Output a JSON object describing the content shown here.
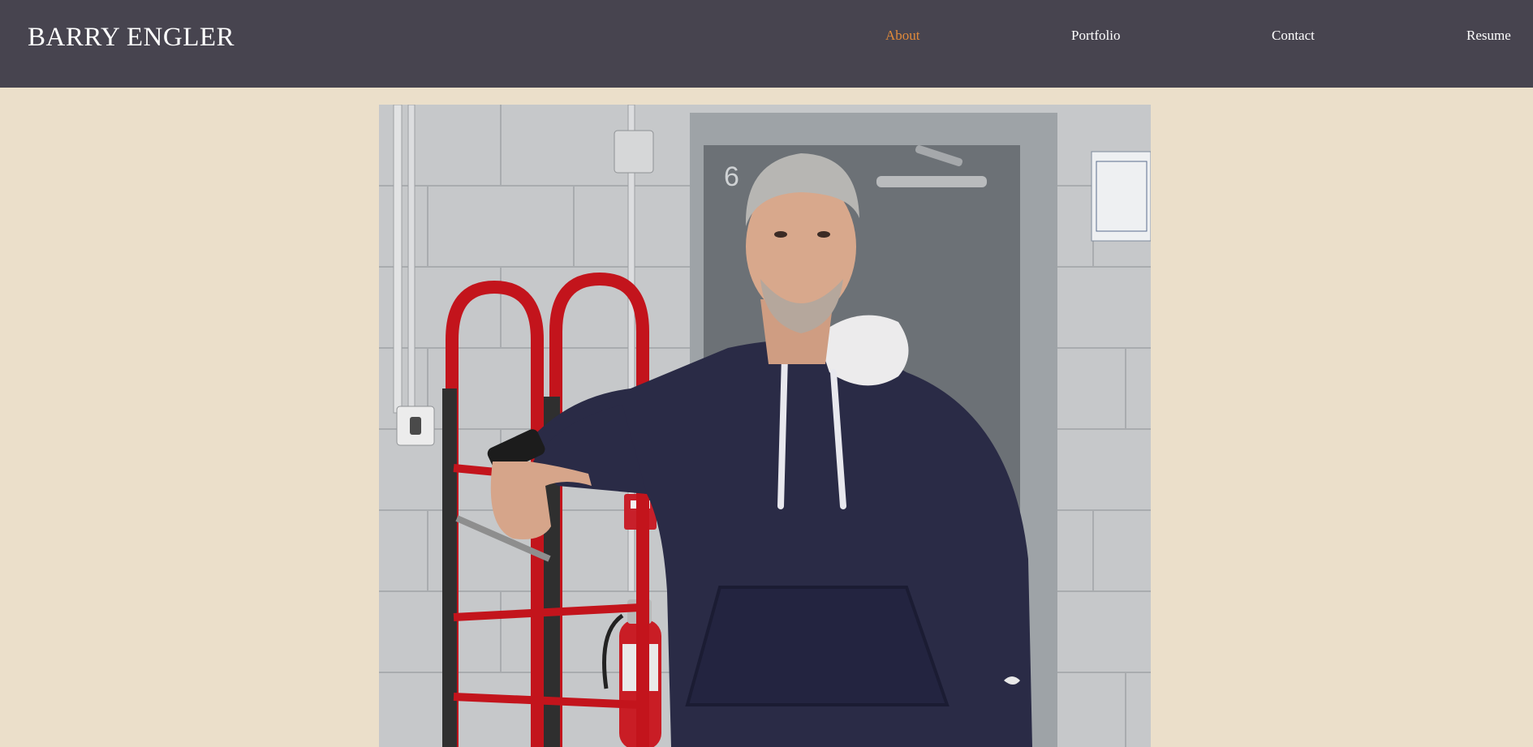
{
  "header": {
    "brand": "BARRY ENGLER",
    "nav": [
      {
        "label": "About",
        "active": true
      },
      {
        "label": "Portfolio",
        "active": false
      },
      {
        "label": "Contact",
        "active": false
      },
      {
        "label": "Resume",
        "active": false
      }
    ]
  },
  "colors": {
    "header_bg": "#47444f",
    "page_bg": "#ebdfca",
    "nav_active": "#e08a3a",
    "nav_text": "#ffffff"
  },
  "hero": {
    "door_number": "6"
  }
}
